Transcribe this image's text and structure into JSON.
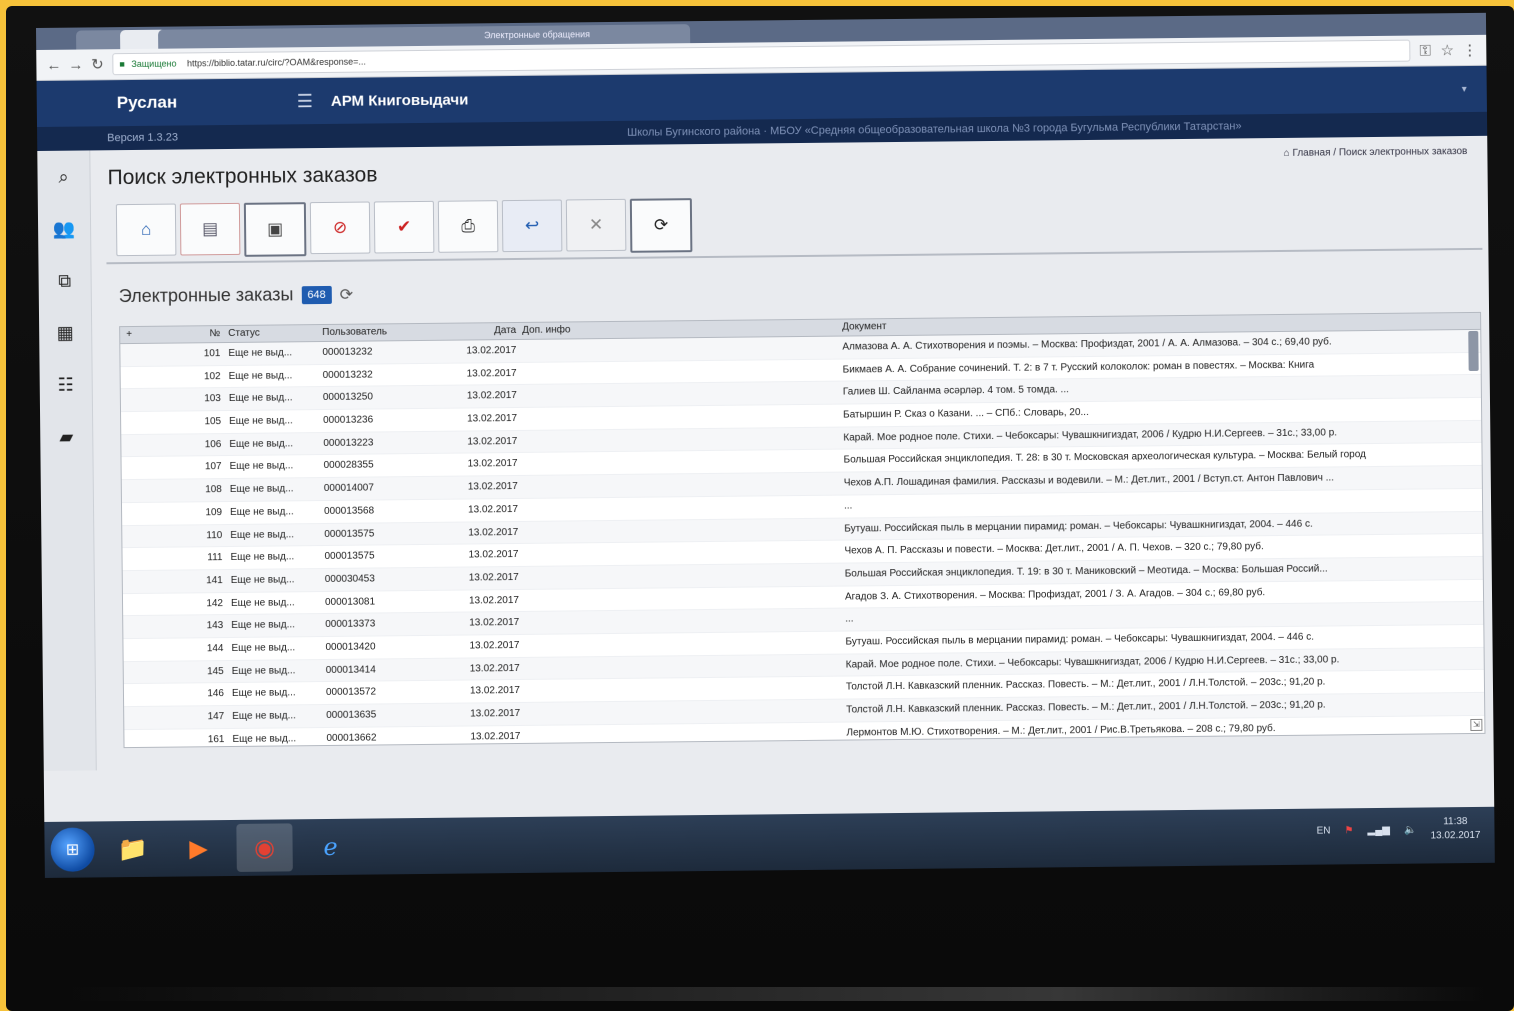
{
  "browser": {
    "tabs": [
      "",
      "",
      "",
      "",
      "",
      "",
      "",
      "",
      "",
      "Электронные обращения"
    ],
    "secure_label": "Защищено",
    "url": "https://biblio.tatar.ru/circ/?OAM&response=..."
  },
  "header": {
    "user": "Руслан",
    "app_title": "АРМ Книговыдачи",
    "version": "Версия 1.3.23",
    "school": "Школы Бугинского района · МБОУ «Средняя общеобразовательная школа №3 города Бугульма Республики Татарстан»"
  },
  "breadcrumb": "Главная / Поиск электронных заказов",
  "page_title": "Поиск электронных заказов",
  "toolbar": [
    {
      "name": "home-icon",
      "glyph": "⌂"
    },
    {
      "name": "reader-icon",
      "glyph": "▤"
    },
    {
      "name": "scan-icon",
      "glyph": "▣"
    },
    {
      "name": "stop-icon",
      "glyph": "⊘"
    },
    {
      "name": "check-icon",
      "glyph": "✔"
    },
    {
      "name": "print-icon",
      "glyph": "⎙"
    },
    {
      "name": "back-icon",
      "glyph": "↩"
    },
    {
      "name": "close-icon",
      "glyph": "✕"
    },
    {
      "name": "refresh-icon",
      "glyph": "⟳"
    }
  ],
  "orders": {
    "title": "Электронные заказы",
    "count": "648"
  },
  "grid": {
    "headers": [
      "+",
      "№",
      "Статус",
      "Пользователь",
      "Дата",
      "Доп. инфо",
      "Документ"
    ],
    "rows": [
      [
        "101",
        "Еще не выд...",
        "000013232",
        "13.02.2017",
        "",
        "Алмазова А. А. Стихотворения и поэмы. – Москва: Профиздат, 2001 / А. А. Алмазова. – 304 с.; 69,40 руб."
      ],
      [
        "102",
        "Еще не выд...",
        "000013232",
        "13.02.2017",
        "",
        "Бикмаев А. А. Собрание сочинений. Т. 2: в 7 т. Русский колоколок: роман в повестях. – Москва: Книга"
      ],
      [
        "103",
        "Еще не выд...",
        "000013250",
        "13.02.2017",
        "",
        "Галиев Ш. Сайланма әсәрләр. 4 том. 5 томда. ..."
      ],
      [
        "105",
        "Еще не выд...",
        "000013236",
        "13.02.2017",
        "",
        "Батыршин Р. Сказ о Казани. ... – СПб.: Словарь, 20..."
      ],
      [
        "106",
        "Еще не выд...",
        "000013223",
        "13.02.2017",
        "",
        "Карай. Мое родное поле. Стихи. – Чебоксары: Чувашкнигиздат, 2006 / Кудрю Н.И.Сергеев. – 31с.; 33,00 р."
      ],
      [
        "107",
        "Еще не выд...",
        "000028355",
        "13.02.2017",
        "",
        "Большая Российская энциклопедия. Т. 28: в 30 т. Московская археологическая культура. – Москва: Белый город"
      ],
      [
        "108",
        "Еще не выд...",
        "000014007",
        "13.02.2017",
        "",
        "Чехов А.П. Лошадиная фамилия. Рассказы и водевили. – М.: Дет.лит., 2001 / Вступ.ст. Антон Павлович ..."
      ],
      [
        "109",
        "Еще не выд...",
        "000013568",
        "13.02.2017",
        "",
        "..."
      ],
      [
        "110",
        "Еще не выд...",
        "000013575",
        "13.02.2017",
        "",
        "Бутуаш. Российская пыль в мерцании пирамид: роман. – Чебоксары: Чувашкнигиздат, 2004. – 446 с."
      ],
      [
        "111",
        "Еще не выд...",
        "000013575",
        "13.02.2017",
        "",
        "Чехов А. П. Рассказы и повести. – Москва: Дет.лит., 2001 / А. П. Чехов. – 320 с.; 79,80 руб."
      ],
      [
        "141",
        "Еще не выд...",
        "000030453",
        "13.02.2017",
        "",
        "Большая Российская энциклопедия. Т. 19: в 30 т. Маниковский – Меотида. – Москва: Большая Россий..."
      ],
      [
        "142",
        "Еще не выд...",
        "000013081",
        "13.02.2017",
        "",
        "Агадов З. А. Стихотворения. – Москва: Профиздат, 2001 / З. А. Агадов. – 304 с.; 69,80 руб."
      ],
      [
        "143",
        "Еще не выд...",
        "000013373",
        "13.02.2017",
        "",
        "..."
      ],
      [
        "144",
        "Еще не выд...",
        "000013420",
        "13.02.2017",
        "",
        "Бутуаш. Российская пыль в мерцании пирамид: роман. – Чебоксары: Чувашкнигиздат, 2004. – 446 с."
      ],
      [
        "145",
        "Еще не выд...",
        "000013414",
        "13.02.2017",
        "",
        "Карай. Мое родное поле. Стихи. – Чебоксары: Чувашкнигиздат, 2006 / Кудрю Н.И.Сергеев. – 31с.; 33,00 р."
      ],
      [
        "146",
        "Еще не выд...",
        "000013572",
        "13.02.2017",
        "",
        "Толстой Л.Н. Кавказский пленник. Рассказ. Повесть. – М.: Дет.лит., 2001 / Л.Н.Толстой. – 203с.; 91,20 р."
      ],
      [
        "147",
        "Еще не выд...",
        "000013635",
        "13.02.2017",
        "",
        "Толстой Л.Н. Кавказский пленник. Рассказ. Повесть. – М.: Дет.лит., 2001 / Л.Н.Толстой. – 203с.; 91,20 р."
      ],
      [
        "161",
        "Еще не выд...",
        "000013662",
        "13.02.2017",
        "",
        "Лермонтов М.Ю. Стихотворения. – М.: Дет.лит., 2001 / Рис.В.Третьякова. – 208 с.; 79,80 руб."
      ]
    ]
  },
  "taskbar": {
    "apps": [
      {
        "name": "explorer-icon",
        "glyph": "📁"
      },
      {
        "name": "media-player-icon",
        "glyph": "▶"
      },
      {
        "name": "chrome-icon",
        "glyph": "◉"
      },
      {
        "name": "ie-icon",
        "glyph": "ℯ"
      }
    ],
    "lang": "EN",
    "time": "11:38",
    "date": "13.02.2017"
  }
}
